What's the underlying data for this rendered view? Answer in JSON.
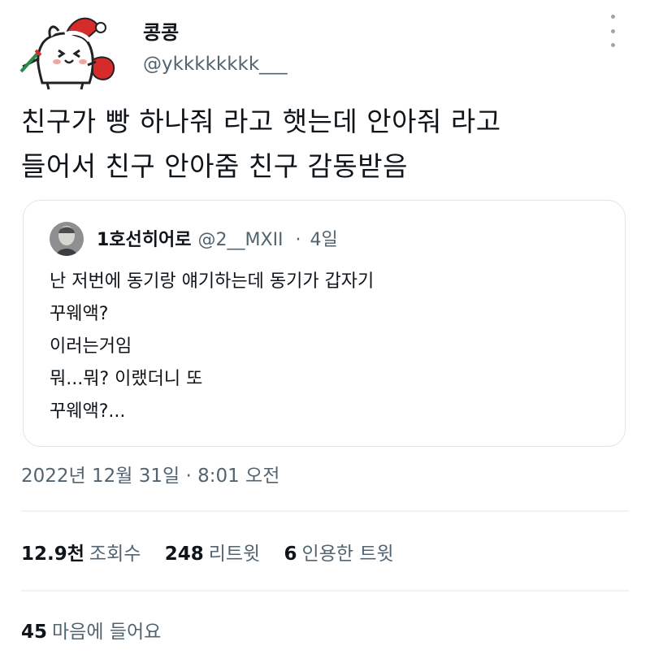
{
  "author": {
    "display_name": "콩콩",
    "handle": "@ykkkkkkkk___"
  },
  "tweet": {
    "text": "친구가 빵 하나줘 라고 햇는데 안아줘 라고\n들어서 친구 안아줌 친구 감동받음"
  },
  "quoted_tweet": {
    "display_name": "1호선히어로",
    "handle": "@2__MXII",
    "separator": "·",
    "age": "4일",
    "text": "난 저번에 동기랑 얘기하는데 동기가 갑자기\n꾸웨액?\n이러는거임\n뭐...뭐? 이랬더니 또\n꾸웨액?..."
  },
  "timestamp": "2022년 12월 31일 · 8:01 오전",
  "stats": {
    "views_count": "12.9천",
    "views_label": "조회수",
    "retweets_count": "248",
    "retweets_label": "리트윗",
    "quotes_count": "6",
    "quotes_label": "인용한 트윗",
    "likes_count": "45",
    "likes_label": "마음에 들어요"
  },
  "colors": {
    "text_primary": "#0f1419",
    "text_secondary": "#536471",
    "border": "#dfe5ea",
    "santa_hat": "#d62b2b"
  },
  "icons": {
    "more": "more-dots-icon"
  }
}
